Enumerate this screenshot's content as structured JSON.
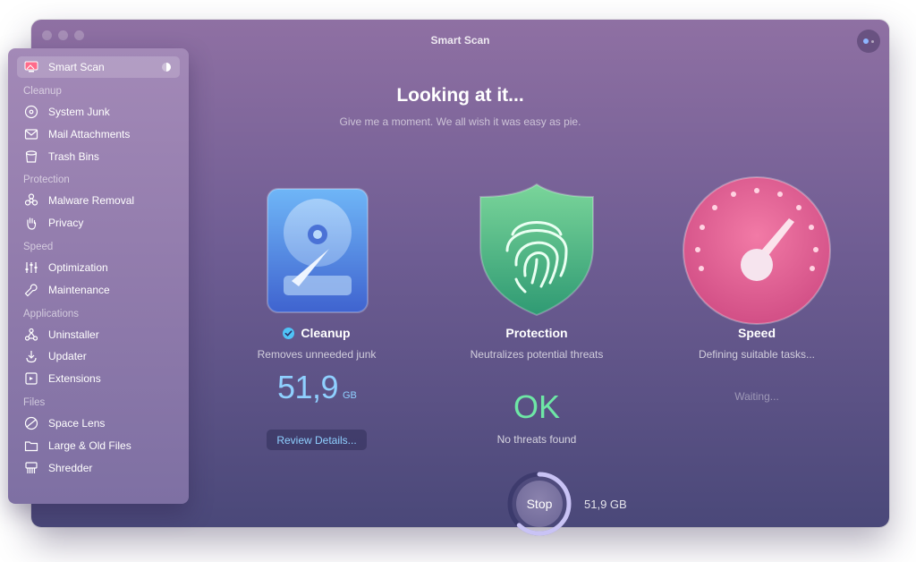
{
  "window": {
    "title": "Smart Scan"
  },
  "sidebar": {
    "top_item": {
      "label": "Smart Scan",
      "icon": "monitor-icon"
    },
    "sections": [
      {
        "label": "Cleanup",
        "items": [
          {
            "label": "System Junk",
            "icon": "disc-icon"
          },
          {
            "label": "Mail Attachments",
            "icon": "envelope-icon"
          },
          {
            "label": "Trash Bins",
            "icon": "trash-icon"
          }
        ]
      },
      {
        "label": "Protection",
        "items": [
          {
            "label": "Malware Removal",
            "icon": "biohazard-icon"
          },
          {
            "label": "Privacy",
            "icon": "hand-icon"
          }
        ]
      },
      {
        "label": "Speed",
        "items": [
          {
            "label": "Optimization",
            "icon": "sliders-icon"
          },
          {
            "label": "Maintenance",
            "icon": "wrench-icon"
          }
        ]
      },
      {
        "label": "Applications",
        "items": [
          {
            "label": "Uninstaller",
            "icon": "uninstaller-icon"
          },
          {
            "label": "Updater",
            "icon": "update-icon"
          },
          {
            "label": "Extensions",
            "icon": "extensions-icon"
          }
        ]
      },
      {
        "label": "Files",
        "items": [
          {
            "label": "Space Lens",
            "icon": "lens-icon"
          },
          {
            "label": "Large & Old Files",
            "icon": "folder-icon"
          },
          {
            "label": "Shredder",
            "icon": "shredder-icon"
          }
        ]
      }
    ]
  },
  "main": {
    "headline": "Looking at it...",
    "subline": "Give me a moment. We all wish it was easy as pie.",
    "cleanup": {
      "title": "Cleanup",
      "description": "Removes unneeded junk",
      "value": "51,9",
      "unit": "GB",
      "review_label": "Review Details..."
    },
    "protection": {
      "title": "Protection",
      "description": "Neutralizes potential threats",
      "status": "OK",
      "note": "No threats found"
    },
    "speed": {
      "title": "Speed",
      "description": "Defining suitable tasks...",
      "status": "Waiting..."
    },
    "stop": {
      "label": "Stop",
      "size": "51,9 GB",
      "progress": 0.62
    }
  },
  "colors": {
    "accent_blue": "#8fd0ff",
    "ok_green": "#6ee7a6",
    "speed_pink": "#e35f92",
    "shield_green": "#3fb57a"
  }
}
